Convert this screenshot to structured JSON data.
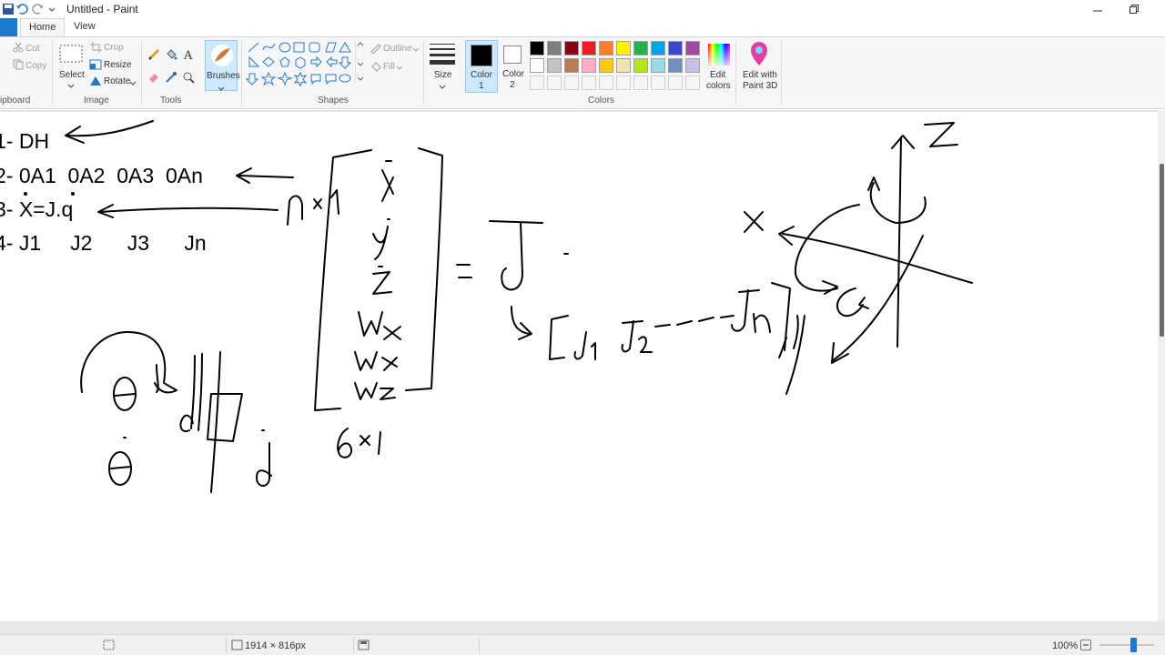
{
  "window": {
    "title": "Untitled - Paint"
  },
  "tabs": {
    "home": "Home",
    "view": "View"
  },
  "ribbon": {
    "clipboard": {
      "label": "ipboard",
      "cut": "Cut",
      "copy": "Copy"
    },
    "image": {
      "label": "Image",
      "select": "Select",
      "crop": "Crop",
      "resize": "Resize",
      "rotate": "Rotate"
    },
    "tools": {
      "label": "Tools"
    },
    "brushes": {
      "label": "Brushes"
    },
    "shapes": {
      "label": "Shapes",
      "outline": "Outline",
      "fill": "Fill"
    },
    "size": {
      "label": "Size"
    },
    "color1": {
      "label": "Color",
      "sub": "1",
      "value": "#000000"
    },
    "color2": {
      "label": "Color",
      "sub": "2",
      "value": "#ffffff"
    },
    "colors": {
      "label": "Colors",
      "edit_label_1": "Edit",
      "edit_label_2": "colors",
      "palette_row1": [
        "#000000",
        "#7f7f7f",
        "#880015",
        "#ed1c24",
        "#ff7f27",
        "#fff200",
        "#22b14c",
        "#00a2e8",
        "#3f48cc",
        "#a349a4"
      ],
      "palette_row2": [
        "#ffffff",
        "#c3c3c3",
        "#b97a57",
        "#ffaec9",
        "#ffc90e",
        "#efe4b0",
        "#b5e61d",
        "#99d9ea",
        "#7092be",
        "#c8bfe7"
      ]
    },
    "paint3d": {
      "label_1": "Edit with",
      "label_2": "Paint 3D"
    }
  },
  "canvas": {
    "typed_lines": [
      "1- DH",
      "2- 0A1  0A2  0A3  0An",
      "3- X=J.q",
      "4- J1     J2      J3      Jn"
    ]
  },
  "status": {
    "canvas_size": "1914 × 816px",
    "zoom": "100%"
  }
}
